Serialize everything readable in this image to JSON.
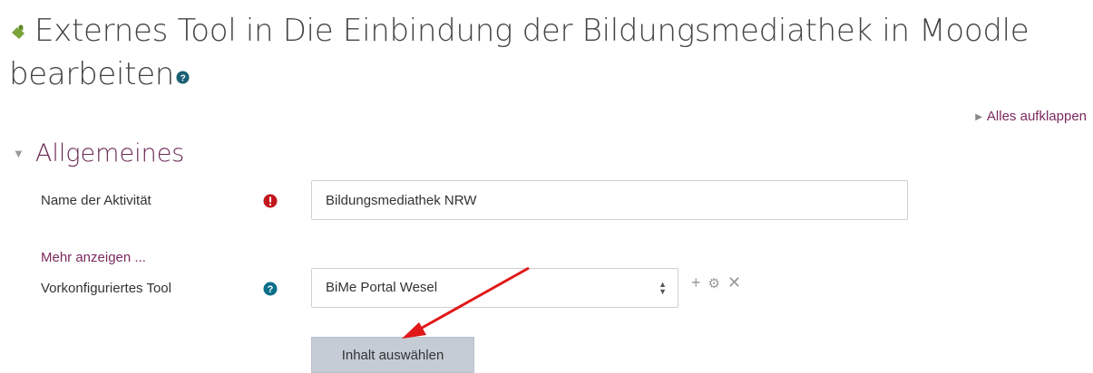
{
  "header": {
    "title": "Externes Tool in Die Einbindung der Bildungsmediathek in Moodle bearbeiten",
    "module_icon": "lti-puzzle-icon",
    "help_icon": "question-circle-icon"
  },
  "expand_all": {
    "label": "Alles aufklappen",
    "icon": "caret-right-icon"
  },
  "section": {
    "title": "Allgemeines",
    "icon": "caret-down-icon"
  },
  "fields": {
    "name": {
      "label": "Name der Aktivität",
      "value": "Bildungsmediathek NRW",
      "required_icon": "exclamation-circle-icon",
      "required_color": "#c1171d"
    },
    "more_link": "Mehr anzeigen ...",
    "tool": {
      "label": "Vorkonfiguriertes Tool",
      "selected": "BiMe Portal Wesel",
      "help_icon": "question-circle-icon",
      "help_color": "#0b6f88",
      "actions": [
        "add-icon",
        "gear-icon",
        "close-icon"
      ]
    }
  },
  "button": {
    "label": "Inhalt auswählen"
  },
  "colors": {
    "link": "#7a2a5e",
    "section_title": "#6b2a56",
    "annotation_arrow": "#e01818",
    "button_bg": "#c5ccd6"
  }
}
